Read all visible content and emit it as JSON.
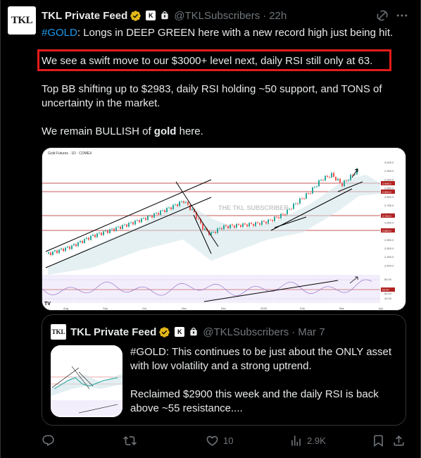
{
  "author": {
    "avatar_text": "TKL",
    "name": "TKL Private Feed",
    "badge_letter": "K",
    "handle": "@TKLSubscribers",
    "separator": "·",
    "time": "22h"
  },
  "tweet": {
    "line1_hashtag": "#GOLD",
    "line1_rest": ": Longs in DEEP GREEN here with a new record high just being hit.",
    "line2": "We see a swift move to our $3000+ level next, daily RSI still only at 63.",
    "line3": "Top BB shifting up to $2983, daily RSI holding ~50 support, and TONS of uncertainty in the market.",
    "line4_a": "We remain BULLISH of ",
    "line4_bold": "gold",
    "line4_b": " here."
  },
  "chart": {
    "title": "Gold Futures · 1D · COMEX",
    "watermark": "THE TKL SUBSCRIBER",
    "x_labels": [
      "Aug",
      "Sep",
      "Oct",
      "Nov",
      "Dec",
      "2025",
      "Feb",
      "Mar",
      "Apr"
    ],
    "y_labels": [
      "3,000.0",
      "2,950.0",
      "2,900.0",
      "2,850.0",
      "2,800.0",
      "2,750.0",
      "2,700.0",
      "2,650.0",
      "2,600.0",
      "2,550.0",
      "2,500.0",
      "2,450.0",
      "2,400.0"
    ],
    "price_tags": [
      "2,948.0",
      "2,900.0",
      "2,740.0",
      "2,650.0"
    ],
    "rsi_labels": [
      "80.00",
      "60.00",
      "40.00"
    ],
    "rsi_tag": "63.00",
    "colors": {
      "up": "#26a69a",
      "down": "#ef5350",
      "level": "#b22222",
      "rsi": "#9575cd"
    }
  },
  "quote": {
    "avatar_text": "TKL",
    "name": "TKL Private Feed",
    "badge_letter": "K",
    "handle": "@TKLSubscribers",
    "separator": "·",
    "time": "Mar 7",
    "text1": "#GOLD: This continues to be just about the ONLY asset with low volatility and a strong uptrend.",
    "text2": "Reclaimed $2900 this week and the daily RSI is back above ~55 resistance...."
  },
  "actions": {
    "reply_count": "",
    "retweet_count": "",
    "like_count": "10",
    "views_count": "2.9K"
  },
  "icons": [
    "verified-icon",
    "lock-icon",
    "grok-icon",
    "more-icon",
    "reply-icon",
    "retweet-icon",
    "like-icon",
    "views-icon",
    "bookmark-icon",
    "share-icon"
  ]
}
